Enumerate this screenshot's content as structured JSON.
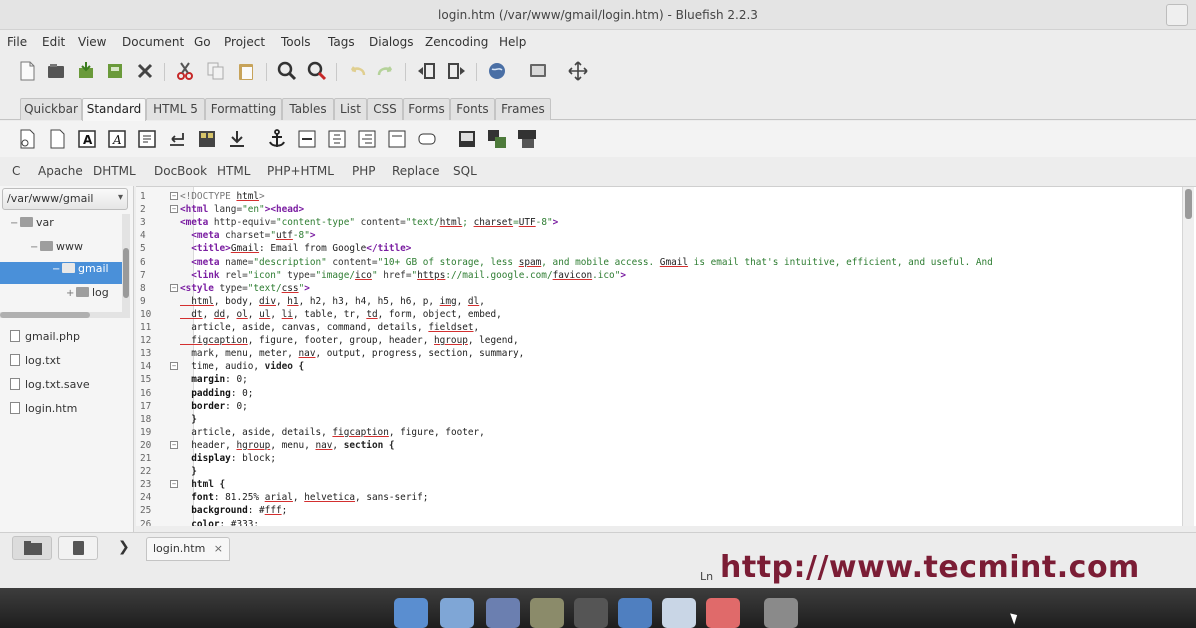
{
  "window": {
    "title": "login.htm (/var/www/gmail/login.htm) - Bluefish 2.2.3"
  },
  "menu": [
    "File",
    "Edit",
    "View",
    "Document",
    "Go",
    "Project",
    "Tools",
    "Tags",
    "Dialogs",
    "Zencoding",
    "Help"
  ],
  "tabs": [
    "Quickbar",
    "Standard",
    "HTML 5",
    "Formatting",
    "Tables",
    "List",
    "CSS",
    "Forms",
    "Fonts",
    "Frames"
  ],
  "active_tab": "Standard",
  "custom_menu": [
    "C",
    "Apache",
    "DHTML",
    "DocBook",
    "HTML",
    "PHP+HTML",
    "PHP",
    "Replace",
    "SQL"
  ],
  "sidebar": {
    "path": "/var/www/gmail",
    "tree": [
      {
        "label": "var",
        "level": 0
      },
      {
        "label": "www",
        "level": 1
      },
      {
        "label": "gmail",
        "level": 2,
        "selected": true
      },
      {
        "label": "log",
        "level": 3
      }
    ],
    "files": [
      "gmail.php",
      "log.txt",
      "log.txt.save",
      "login.htm"
    ]
  },
  "editor": {
    "lines": [
      {
        "n": "1",
        "fold": true,
        "segs": [
          {
            "c": "com",
            "t": "<!DOCTYPE "
          },
          {
            "c": "spell",
            "t": "html"
          },
          {
            "c": "com",
            "t": ">"
          }
        ]
      },
      {
        "n": "2",
        "fold": true,
        "segs": [
          {
            "c": "tag",
            "t": "<html "
          },
          {
            "c": "attr",
            "t": "lang="
          },
          {
            "c": "str",
            "t": "\"en\""
          },
          {
            "c": "tag",
            "t": "><head>"
          }
        ]
      },
      {
        "n": "3",
        "fold": false,
        "segs": [
          {
            "c": "tag",
            "t": "<meta "
          },
          {
            "c": "attr",
            "t": "http-equiv="
          },
          {
            "c": "str",
            "t": "\"content-type\""
          },
          {
            "c": "attr",
            "t": " content="
          },
          {
            "c": "str",
            "t": "\"text/"
          },
          {
            "c": "spell",
            "t": "html"
          },
          {
            "c": "str",
            "t": "; "
          },
          {
            "c": "spell",
            "t": "charset"
          },
          {
            "c": "str",
            "t": "="
          },
          {
            "c": "spell",
            "t": "UTF"
          },
          {
            "c": "str",
            "t": "-8\""
          },
          {
            "c": "tag",
            "t": ">"
          }
        ]
      },
      {
        "n": "4",
        "fold": false,
        "segs": [
          {
            "c": "tag",
            "t": "  <meta "
          },
          {
            "c": "attr",
            "t": "charset="
          },
          {
            "c": "str",
            "t": "\""
          },
          {
            "c": "spell",
            "t": "utf"
          },
          {
            "c": "str",
            "t": "-8\""
          },
          {
            "c": "tag",
            "t": ">"
          }
        ]
      },
      {
        "n": "5",
        "fold": false,
        "segs": [
          {
            "c": "tag",
            "t": "  <title>"
          },
          {
            "c": "spell",
            "t": "Gmail"
          },
          {
            "c": "plain",
            "t": ": Email from Google"
          },
          {
            "c": "tag",
            "t": "</title>"
          }
        ]
      },
      {
        "n": "6",
        "fold": false,
        "segs": [
          {
            "c": "tag",
            "t": "  <meta "
          },
          {
            "c": "attr",
            "t": "name="
          },
          {
            "c": "str",
            "t": "\"description\""
          },
          {
            "c": "attr",
            "t": " content="
          },
          {
            "c": "str",
            "t": "\"10+ GB of storage, less "
          },
          {
            "c": "spell",
            "t": "spam"
          },
          {
            "c": "str",
            "t": ", and mobile access. "
          },
          {
            "c": "spell",
            "t": "Gmail"
          },
          {
            "c": "str",
            "t": " is email that's intuitive, efficient, and useful. And"
          }
        ]
      },
      {
        "n": "7",
        "fold": false,
        "segs": [
          {
            "c": "tag",
            "t": "  <link "
          },
          {
            "c": "attr",
            "t": "rel="
          },
          {
            "c": "str",
            "t": "\"icon\""
          },
          {
            "c": "attr",
            "t": " type="
          },
          {
            "c": "str",
            "t": "\"image/"
          },
          {
            "c": "spell",
            "t": "ico"
          },
          {
            "c": "str",
            "t": "\""
          },
          {
            "c": "attr",
            "t": " href="
          },
          {
            "c": "str",
            "t": "\""
          },
          {
            "c": "spell",
            "t": "https"
          },
          {
            "c": "str",
            "t": "://mail.google.com/"
          },
          {
            "c": "spell",
            "t": "favicon"
          },
          {
            "c": "str",
            "t": ".ico\""
          },
          {
            "c": "tag",
            "t": ">"
          }
        ]
      },
      {
        "n": "8",
        "fold": true,
        "segs": [
          {
            "c": "tag",
            "t": "<style "
          },
          {
            "c": "attr",
            "t": "type="
          },
          {
            "c": "str",
            "t": "\"text/"
          },
          {
            "c": "spell",
            "t": "css"
          },
          {
            "c": "str",
            "t": "\""
          },
          {
            "c": "tag",
            "t": ">"
          }
        ]
      },
      {
        "n": "9",
        "fold": false,
        "segs": [
          {
            "c": "spell",
            "t": "  html"
          },
          {
            "c": "plain",
            "t": ", body, "
          },
          {
            "c": "spell",
            "t": "div"
          },
          {
            "c": "plain",
            "t": ", "
          },
          {
            "c": "spell",
            "t": "h1"
          },
          {
            "c": "plain",
            "t": ", h2, h3, h4, h5, h6, p, "
          },
          {
            "c": "spell",
            "t": "img"
          },
          {
            "c": "plain",
            "t": ", "
          },
          {
            "c": "spell",
            "t": "dl"
          },
          {
            "c": "plain",
            "t": ","
          }
        ]
      },
      {
        "n": "10",
        "fold": false,
        "segs": [
          {
            "c": "spell",
            "t": "  dt"
          },
          {
            "c": "plain",
            "t": ", "
          },
          {
            "c": "spell",
            "t": "dd"
          },
          {
            "c": "plain",
            "t": ", "
          },
          {
            "c": "spell",
            "t": "ol"
          },
          {
            "c": "plain",
            "t": ", "
          },
          {
            "c": "spell",
            "t": "ul"
          },
          {
            "c": "plain",
            "t": ", "
          },
          {
            "c": "spell",
            "t": "li"
          },
          {
            "c": "plain",
            "t": ", table, tr, "
          },
          {
            "c": "spell",
            "t": "td"
          },
          {
            "c": "plain",
            "t": ", form, object, embed,"
          }
        ]
      },
      {
        "n": "11",
        "fold": false,
        "segs": [
          {
            "c": "plain",
            "t": "  article, aside, canvas, command, details, "
          },
          {
            "c": "spell",
            "t": "fieldset"
          },
          {
            "c": "plain",
            "t": ","
          }
        ]
      },
      {
        "n": "12",
        "fold": false,
        "segs": [
          {
            "c": "spell",
            "t": "  figcaption"
          },
          {
            "c": "plain",
            "t": ", figure, footer, group, header, "
          },
          {
            "c": "spell",
            "t": "hgroup"
          },
          {
            "c": "plain",
            "t": ", legend,"
          }
        ]
      },
      {
        "n": "13",
        "fold": false,
        "segs": [
          {
            "c": "plain",
            "t": "  mark, menu, meter, "
          },
          {
            "c": "spell",
            "t": "nav"
          },
          {
            "c": "plain",
            "t": ", output, progress, section, summary,"
          }
        ]
      },
      {
        "n": "14",
        "fold": true,
        "segs": [
          {
            "c": "plain",
            "t": "  time, audio, "
          },
          {
            "c": "kw",
            "t": "video {"
          }
        ]
      },
      {
        "n": "15",
        "fold": false,
        "segs": [
          {
            "c": "prop",
            "t": "  margin"
          },
          {
            "c": "plain",
            "t": ": 0;"
          }
        ]
      },
      {
        "n": "16",
        "fold": false,
        "segs": [
          {
            "c": "prop",
            "t": "  padding"
          },
          {
            "c": "plain",
            "t": ": 0;"
          }
        ]
      },
      {
        "n": "17",
        "fold": false,
        "segs": [
          {
            "c": "prop",
            "t": "  border"
          },
          {
            "c": "plain",
            "t": ": 0;"
          }
        ]
      },
      {
        "n": "18",
        "fold": false,
        "segs": [
          {
            "c": "kw",
            "t": "  }"
          }
        ]
      },
      {
        "n": "19",
        "fold": false,
        "segs": [
          {
            "c": "plain",
            "t": "  article, aside, details, "
          },
          {
            "c": "spell",
            "t": "figcaption"
          },
          {
            "c": "plain",
            "t": ", figure, footer,"
          }
        ]
      },
      {
        "n": "20",
        "fold": true,
        "segs": [
          {
            "c": "plain",
            "t": "  header, "
          },
          {
            "c": "spell",
            "t": "hgroup"
          },
          {
            "c": "plain",
            "t": ", menu, "
          },
          {
            "c": "spell",
            "t": "nav"
          },
          {
            "c": "plain",
            "t": ", "
          },
          {
            "c": "kw",
            "t": "section {"
          }
        ]
      },
      {
        "n": "21",
        "fold": false,
        "segs": [
          {
            "c": "prop",
            "t": "  display"
          },
          {
            "c": "plain",
            "t": ": block;"
          }
        ]
      },
      {
        "n": "22",
        "fold": false,
        "segs": [
          {
            "c": "kw",
            "t": "  }"
          }
        ]
      },
      {
        "n": "23",
        "fold": true,
        "segs": [
          {
            "c": "kw",
            "t": "  html {"
          }
        ]
      },
      {
        "n": "24",
        "fold": false,
        "segs": [
          {
            "c": "prop",
            "t": "  font"
          },
          {
            "c": "plain",
            "t": ": 81.25% "
          },
          {
            "c": "spell",
            "t": "arial"
          },
          {
            "c": "plain",
            "t": ", "
          },
          {
            "c": "spell",
            "t": "helvetica"
          },
          {
            "c": "plain",
            "t": ", sans-serif;"
          }
        ]
      },
      {
        "n": "25",
        "fold": false,
        "segs": [
          {
            "c": "prop",
            "t": "  background"
          },
          {
            "c": "plain",
            "t": ": #"
          },
          {
            "c": "spell",
            "t": "fff"
          },
          {
            "c": "plain",
            "t": ";"
          }
        ]
      },
      {
        "n": "26",
        "fold": false,
        "segs": [
          {
            "c": "prop",
            "t": "  color"
          },
          {
            "c": "plain",
            "t": ": #333;"
          }
        ]
      }
    ]
  },
  "open_tab": {
    "label": "login.htm",
    "close": "×"
  },
  "status": {
    "ln": "Ln"
  },
  "watermark": "http://www.tecmint.com",
  "colors": {
    "selection": "#4a90d9",
    "tag": "#7b1fa2",
    "string": "#2e7d32",
    "watermark": "#7b1d35"
  }
}
